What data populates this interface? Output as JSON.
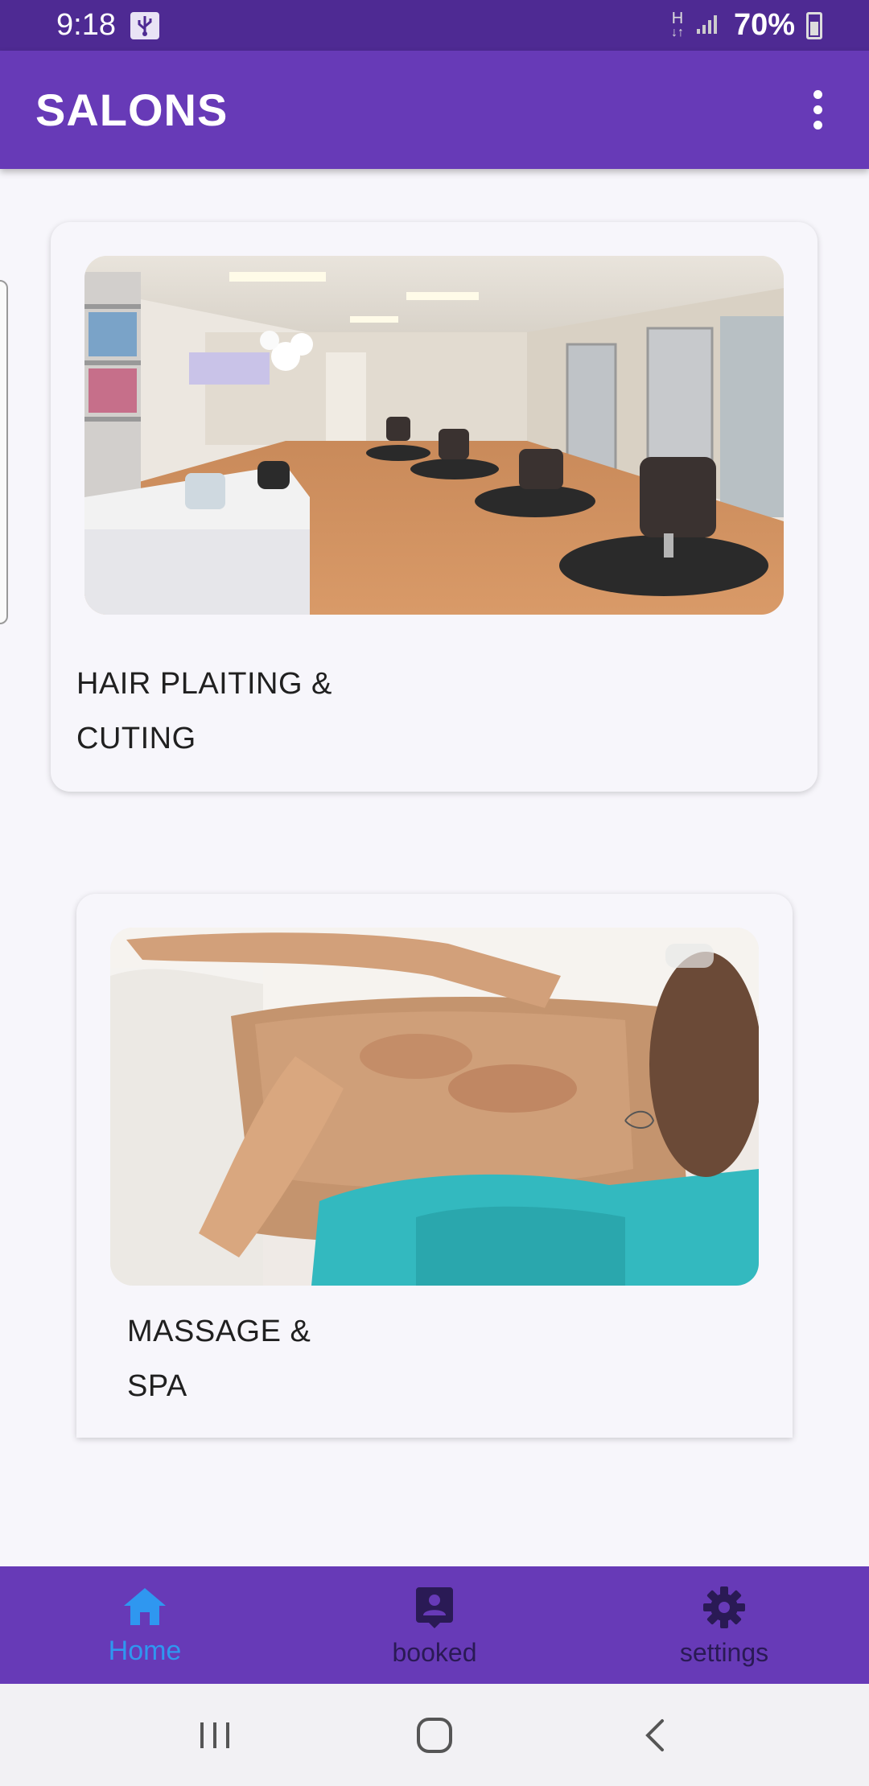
{
  "status_bar": {
    "time": "9:18",
    "network_type": "H",
    "battery": "70%",
    "icons": [
      "usb-icon",
      "data-arrows-icon",
      "signal-icon",
      "battery-charging-icon"
    ]
  },
  "app_bar": {
    "title": "SALONS",
    "menu_icon": "more-vert-icon"
  },
  "cards": [
    {
      "title_line1": "HAIR PLAITING  &",
      "title_line2": "CUTING",
      "image": "salon-interior-photo"
    },
    {
      "title_line1": "MASSAGE &",
      "title_line2": "SPA",
      "image": "massage-photo"
    }
  ],
  "bottom_nav": {
    "items": [
      {
        "label": "Home",
        "icon": "home-icon",
        "active": true
      },
      {
        "label": "booked",
        "icon": "contact-icon",
        "active": false
      },
      {
        "label": "settings",
        "icon": "gear-icon",
        "active": false
      }
    ],
    "active_color": "#2f97f0",
    "background": "#673ab7"
  },
  "system_nav": {
    "buttons": [
      "recents-icon",
      "home-circle-icon",
      "back-icon"
    ]
  },
  "colors": {
    "status_bar": "#4e2a93",
    "app_bar": "#673ab7",
    "page_background": "#f7f6fb"
  }
}
